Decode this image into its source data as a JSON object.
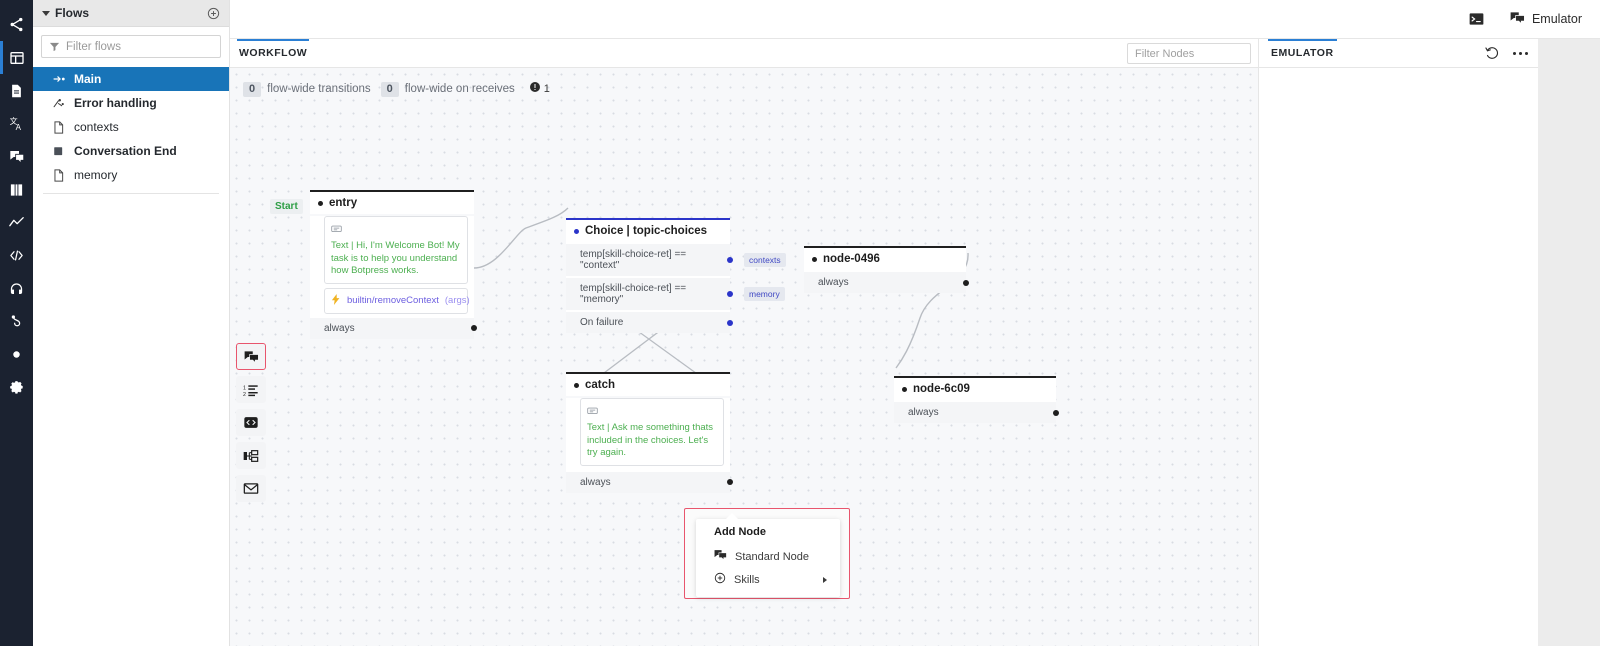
{
  "rail": {
    "items": [
      {
        "name": "share-nodes-icon",
        "label": "Share"
      },
      {
        "name": "dashboard-icon",
        "label": "Dashboard",
        "active": true
      },
      {
        "name": "document-icon",
        "label": "Content"
      },
      {
        "name": "translate-icon",
        "label": "Translate"
      },
      {
        "name": "chat-bubbles-icon",
        "label": "Conversations"
      },
      {
        "name": "book-icon",
        "label": "Library"
      },
      {
        "name": "analytics-icon",
        "label": "Analytics"
      },
      {
        "name": "code-icon",
        "label": "Code Editor"
      },
      {
        "name": "headset-icon",
        "label": "Support"
      },
      {
        "name": "branch-icon",
        "label": "NLU"
      },
      {
        "name": "circle-icon",
        "label": "Status"
      }
    ],
    "settings": {
      "name": "gear-icon",
      "label": "Settings"
    }
  },
  "sidebar": {
    "title": "Flows",
    "add_label": "+",
    "filter": {
      "placeholder": "Filter flows",
      "value": ""
    },
    "items": [
      {
        "label": "Main",
        "icon": "flow-start-icon",
        "active": true,
        "bold": true
      },
      {
        "label": "Error handling",
        "icon": "error-flow-icon",
        "active": false,
        "bold": true
      },
      {
        "label": "contexts",
        "icon": "file-icon",
        "active": false,
        "bold": false
      },
      {
        "label": "Conversation End",
        "icon": "square-icon",
        "active": false,
        "bold": true
      },
      {
        "label": "memory",
        "icon": "file-icon",
        "active": false,
        "bold": false
      }
    ]
  },
  "topbar": {
    "terminal_label": "",
    "emulator_label": "Emulator"
  },
  "workflow": {
    "tab_label": "WORKFLOW",
    "filter_nodes": {
      "placeholder": "Filter Nodes",
      "value": ""
    },
    "meta": {
      "transitions_count": "0",
      "transitions_label": "flow-wide transitions",
      "receives_count": "0",
      "receives_label": "flow-wide on receives",
      "warning_count": "1"
    },
    "node_toolbar": [
      {
        "name": "standard-node-tool",
        "icon": "chat-bubbles-icon",
        "selected": true
      },
      {
        "name": "ordered-list-node-tool",
        "icon": "numbered-list-icon",
        "selected": false
      },
      {
        "name": "code-node-tool",
        "icon": "code-brackets-icon",
        "selected": false
      },
      {
        "name": "split-node-tool",
        "icon": "split-flow-icon",
        "selected": false
      },
      {
        "name": "message-node-tool",
        "icon": "envelope-icon",
        "selected": false
      }
    ]
  },
  "nodes": {
    "entry": {
      "badge": "Start",
      "title": "entry",
      "content": "Text | Hi, I'm Welcome Bot! My task is to help you understand how Botpress works.",
      "action": "builtin/removeContext",
      "action_args": "(args)",
      "transition": "always"
    },
    "choice": {
      "title": "Choice | topic-choices",
      "rows": [
        {
          "label": "temp[skill-choice-ret] == \"context\"",
          "chip": "contexts"
        },
        {
          "label": "temp[skill-choice-ret] == \"memory\"",
          "chip": "memory"
        },
        {
          "label": "On failure",
          "chip": ""
        }
      ]
    },
    "node0496": {
      "title": "node-0496",
      "transition": "always"
    },
    "catch": {
      "title": "catch",
      "content": "Text | Ask me something thats included in the choices. Let's try again.",
      "transition": "always"
    },
    "node6c09": {
      "title": "node-6c09",
      "transition": "always"
    }
  },
  "context_menu": {
    "title": "Add Node",
    "items": [
      {
        "label": "Standard Node",
        "icon": "chat-bubbles-icon",
        "submenu": false
      },
      {
        "label": "Skills",
        "icon": "plus-circle-icon",
        "submenu": true
      }
    ]
  },
  "emulator": {
    "tab_label": "EMULATOR",
    "reset_label": "",
    "more_label": ""
  },
  "colors": {
    "accent_blue": "#2b7fd4",
    "sidebar_dark": "#1b2230",
    "active_blue": "#1874b8",
    "node_blue": "#2b35c9",
    "content_green": "#4caf50",
    "action_purple": "#6d5fe0",
    "highlight_red": "#e8556d",
    "start_green": "#2e9e45"
  }
}
